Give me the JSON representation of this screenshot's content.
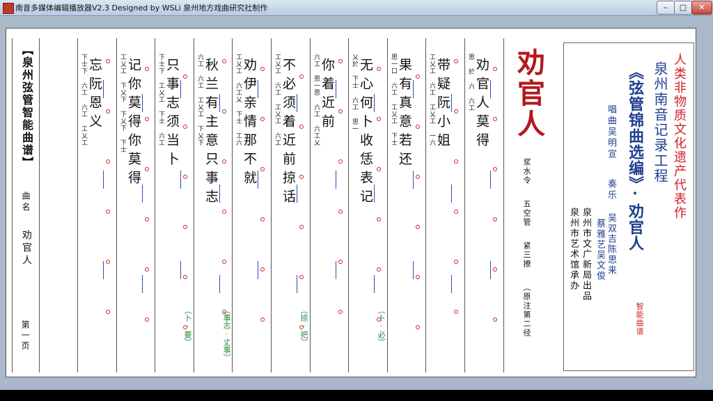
{
  "window": {
    "title": "南音多媒体编辑播放器V2.3   Designed by WSLi  泉州地方戏曲研究社制作",
    "min_label": "–",
    "max_label": "□",
    "close_label": "✕"
  },
  "score": {
    "left_margin": {
      "book_title": "【泉州弦管智能曲谱】",
      "name_label": "曲名",
      "song": "劝官人",
      "page": "第一页"
    },
    "columns": [
      {
        "lyrics": "忘阮恩义",
        "gongche": "下士下 六工 六工 工乂工",
        "green": ""
      },
      {
        "lyrics": "记你莫得你莫得",
        "gongche": "工乂工 下乂下 下乂下 下士",
        "green": ""
      },
      {
        "lyrics": "只事志须当卜",
        "gongche": "下士下 工乂工 下士 六工",
        "green": "（卜·要）"
      },
      {
        "lyrics": "秋兰有主意只事志",
        "gongche": "六工 六工 工乂工 下乂下",
        "green": "（事志·丈事）"
      },
      {
        "lyrics": "劝伊亲情那不就",
        "gongche": "工乂工 六工乂 下士 工六",
        "green": ""
      },
      {
        "lyrics": "不必须着近前掠话",
        "gongche": "工乂工 六工 工乂工 六工",
        "green": "（掠·把）"
      },
      {
        "lyrics": "你着近前",
        "gongche": "六工 思一思 六工 六工乂",
        "green": ""
      },
      {
        "lyrics": "无心何卜收恁表记",
        "gongche": "乂於 下士 六工 思一",
        "green": "（卜·必）"
      },
      {
        "lyrics": "果有真意若还",
        "gongche": "思一口 六工 工乂工 下士",
        "green": ""
      },
      {
        "lyrics": "带疑阮小姐",
        "gongche": "工乂工 六工 工乂工 一六",
        "green": ""
      },
      {
        "lyrics": "劝官人莫得",
        "gongche": "思 於 六 六工",
        "green": ""
      }
    ],
    "title_big": "劝官人",
    "qupai": "浆水令 五空管 紧三撩 （原注第二径",
    "qupai_parts": [
      "浆水令",
      "五空管",
      "紧三撩",
      "（原注第二径"
    ]
  },
  "cover": {
    "slogan": "人类非物质文化遗产代表作",
    "project": "泉州南音记录工程",
    "series": "《弦管锦曲选编》·劝官人",
    "singer": "唱曲吴明宣",
    "players_label": "奏乐",
    "players_col1": "吴双吉陈思来",
    "players_col2": "蔡雅艺吴文俊",
    "smart_notation": "智能曲谱",
    "publisher": "泉州市文广新局出品",
    "producer": "泉州市艺术馆承办",
    "colors": {
      "red": "#d0202a",
      "blue": "#1d3f8f",
      "accent_red": "#b3181e"
    }
  }
}
